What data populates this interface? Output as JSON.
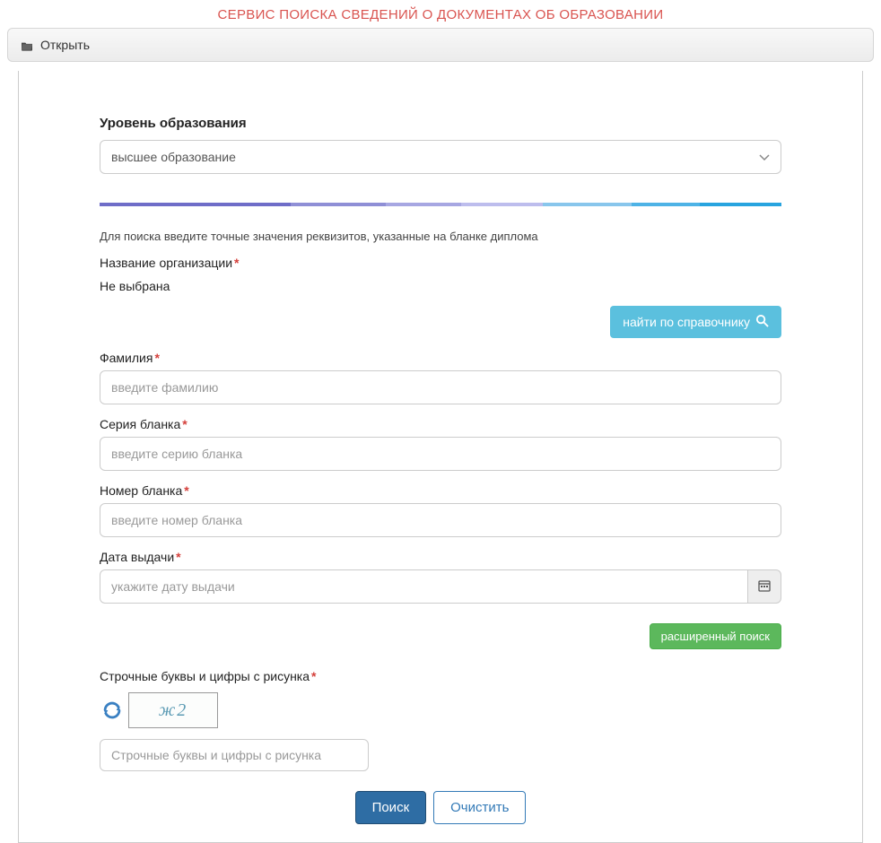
{
  "header": {
    "title": "СЕРВИС ПОИСКА СВЕДЕНИЙ О ДОКУМЕНТАХ ОБ ОБРАЗОВАНИИ"
  },
  "panel": {
    "open_label": "Открыть"
  },
  "form": {
    "education_level_label": "Уровень образования",
    "education_level_value": "высшее образование",
    "hint": "Для поиска введите точные значения реквизитов, указанные на бланке диплома",
    "org_label": "Название организации",
    "org_status": "Не выбрана",
    "org_find_button": "найти по справочнику",
    "lastname_label": "Фамилия",
    "lastname_placeholder": "введите фамилию",
    "series_label": "Серия бланка",
    "series_placeholder": "введите серию бланка",
    "number_label": "Номер бланка",
    "number_placeholder": "введите номер бланка",
    "date_label": "Дата выдачи",
    "date_placeholder": "укажите дату выдачи",
    "advanced_label": "расширенный поиск",
    "captcha_label": "Строчные буквы и цифры с рисунка",
    "captcha_text": "ж2",
    "captcha_placeholder": "Строчные буквы и цифры с рисунка",
    "search_button": "Поиск",
    "clear_button": "Очистить"
  }
}
